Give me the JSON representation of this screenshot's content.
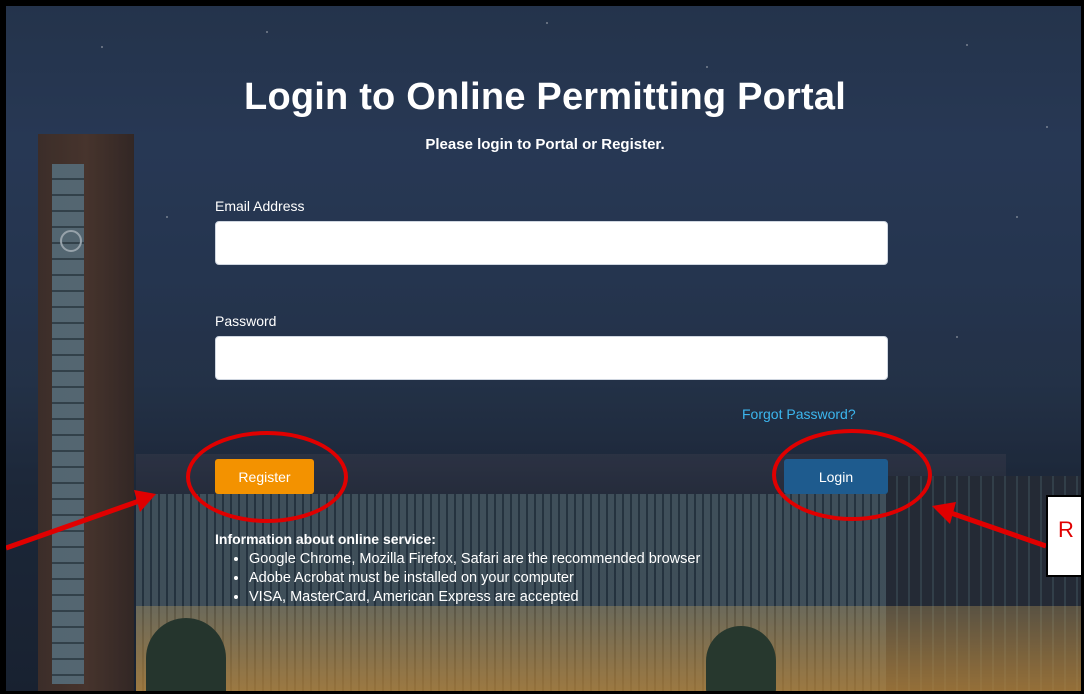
{
  "page": {
    "title": "Login to Online Permitting Portal",
    "subtitle": "Please login to Portal or Register."
  },
  "form": {
    "email": {
      "label": "Email Address",
      "value": "",
      "placeholder": ""
    },
    "password": {
      "label": "Password",
      "value": "",
      "placeholder": ""
    },
    "forgot_label": "Forgot Password?",
    "register_label": "Register",
    "login_label": "Login"
  },
  "info": {
    "heading": "Information about online service:",
    "items": [
      "Google Chrome, Mozilla Firefox, Safari are the recommended browser",
      "Adobe Acrobat must be installed on your computer",
      "VISA, MasterCard, American Express are accepted"
    ]
  },
  "annotation": {
    "callout_text": "R",
    "color": "#e00000"
  },
  "colors": {
    "register_button": "#f39200",
    "login_button": "#1e5b8e",
    "link": "#3cb6ee"
  }
}
